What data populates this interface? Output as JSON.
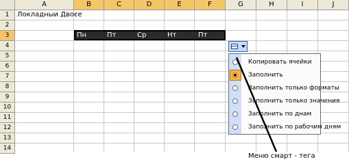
{
  "columns": [
    "A",
    "B",
    "C",
    "D",
    "E",
    "F",
    "G",
    "H",
    "I",
    "J"
  ],
  "selected_columns": [
    "B",
    "C",
    "D",
    "E",
    "F"
  ],
  "rows": [
    "1",
    "2",
    "3",
    "4",
    "5",
    "6",
    "7",
    "8",
    "9",
    "10",
    "11",
    "12",
    "13",
    "14"
  ],
  "selected_rows": [
    "3"
  ],
  "cells": {
    "A1": "Локладныи Двоєе",
    "B3": "Пн",
    "C3": "Пт",
    "D3": "Ср",
    "E3": "Нт",
    "F3": "Пт"
  },
  "smart_tag_menu": {
    "items": [
      {
        "label": "Копировать ячейки",
        "selected": false,
        "highlighted": false
      },
      {
        "label": "Заполнить",
        "selected": true,
        "highlighted": true
      },
      {
        "label": "Заполнить только форматы",
        "selected": false,
        "highlighted": false
      },
      {
        "label": "Заполнить только значения",
        "selected": false,
        "highlighted": false
      },
      {
        "label": "Заполнить по днам",
        "selected": false,
        "highlighted": false
      },
      {
        "label": "Заполнить по рабочим дням",
        "selected": false,
        "highlighted": false
      }
    ]
  },
  "caption": "Меню смарт - тега"
}
